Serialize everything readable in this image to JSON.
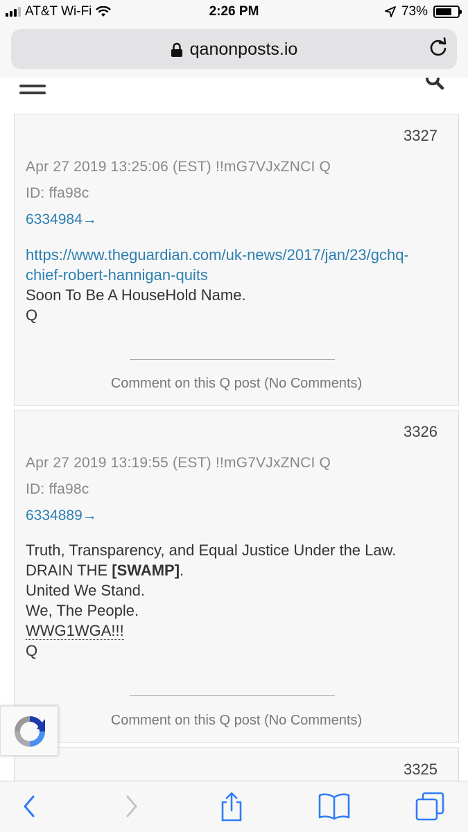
{
  "status_bar": {
    "carrier": "AT&T Wi-Fi",
    "time": "2:26 PM",
    "battery": "73%",
    "battery_level": 0.73
  },
  "browser": {
    "url": "qanonposts.io"
  },
  "posts": [
    {
      "number": "3327",
      "meta": "Apr 27 2019 13:25:06 (EST) !!mG7VJxZNCI Q",
      "id": "ID: ffa98c",
      "ref_link": "6334984→",
      "url_line1": "https://www.theguardian.com/uk-news/2017/jan/23/gchq-",
      "url_line2": "chief-robert-hannigan-quits",
      "line1": "Soon To Be A HouseHold Name.",
      "sign": "Q",
      "comment": "Comment on this Q post (No Comments)"
    },
    {
      "number": "3326",
      "meta": "Apr 27 2019 13:19:55 (EST) !!mG7VJxZNCI Q",
      "id": "ID: ffa98c",
      "ref_link": "6334889→",
      "line1": "Truth, Transparency, and Equal Justice Under the Law.",
      "line2_a": "DRAIN THE ",
      "line2_b": "[SWAMP]",
      "line2_c": ".",
      "line3": "United We Stand.",
      "line4": "We, The People.",
      "line5": "WWG1WGA!!!",
      "sign": "Q",
      "comment": "Comment on this Q post (No Comments)"
    },
    {
      "number": "3325"
    }
  ],
  "icons": {
    "wifi": "wifi-icon",
    "location": "location-arrow-icon",
    "lock": "lock-icon",
    "reload": "reload-icon",
    "menu": "hamburger-menu-icon",
    "search": "search-icon",
    "back": "back-chevron-icon",
    "forward": "forward-chevron-icon",
    "share": "share-icon",
    "bookmarks": "bookmarks-icon",
    "tabs": "tabs-icon"
  },
  "colors": {
    "link": "#2e7fb0",
    "toolbar_icon": "#2f7cf6"
  }
}
